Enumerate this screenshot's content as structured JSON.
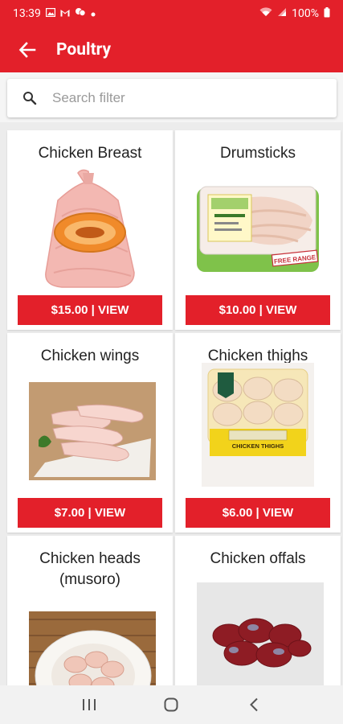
{
  "status_bar": {
    "time": "13:39",
    "battery": "100%",
    "icons": [
      "image-icon",
      "gmail-icon",
      "chat-icon",
      "dot-icon",
      "wifi-icon",
      "signal-icon",
      "battery-icon"
    ]
  },
  "app_bar": {
    "title": "Poultry",
    "back_icon": "arrow-left-icon"
  },
  "search": {
    "placeholder": "Search filter",
    "value": "",
    "icon": "search-icon"
  },
  "products": [
    {
      "name": "Chicken Breast",
      "button": "$15.00 | VIEW"
    },
    {
      "name": "Drumsticks",
      "button": "$10.00 | VIEW"
    },
    {
      "name": "Chicken wings",
      "button": "$7.00 | VIEW"
    },
    {
      "name": "Chicken thighs",
      "button": "$6.00 | VIEW"
    },
    {
      "name": "Chicken heads (musoro)",
      "button": ""
    },
    {
      "name": "Chicken offals",
      "button": ""
    }
  ],
  "package_labels": {
    "drumsticks_tag": "FREE RANGE",
    "thighs_label": "CHICKEN THIGHS"
  },
  "colors": {
    "primary": "#e3202a",
    "background": "#ececec",
    "card": "#ffffff"
  },
  "nav_bar": {
    "icons": [
      "recents-icon",
      "home-icon",
      "back-icon"
    ]
  }
}
